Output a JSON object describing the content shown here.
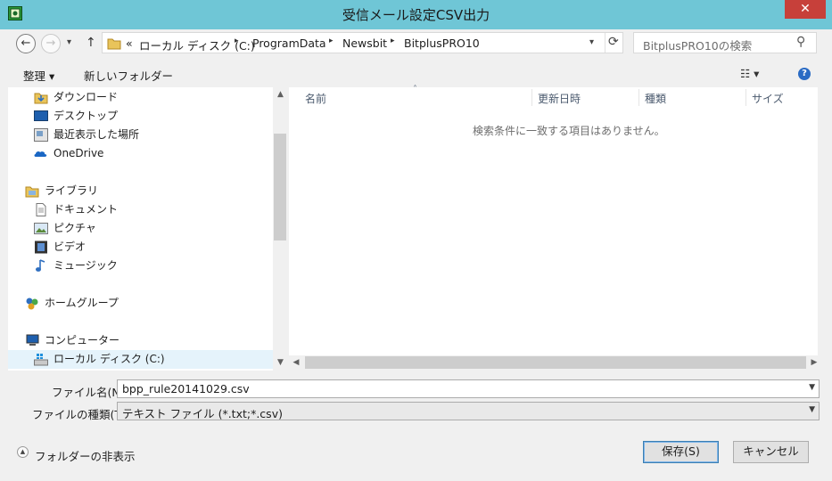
{
  "window": {
    "title": "受信メール設定CSV出力",
    "close_glyph": "✕"
  },
  "nav": {
    "back": "←",
    "forward": "→",
    "dropdown": "▾",
    "up": "↑"
  },
  "address": {
    "overflow": "«",
    "crumbs": [
      "ローカル ディスク (C:)",
      "ProgramData",
      "Newsbit",
      "BitplusPRO10"
    ],
    "dropdown": "▾",
    "refresh": "⟳"
  },
  "search": {
    "placeholder": "BitplusPRO10の検索",
    "icon": "⚲"
  },
  "toolbar": {
    "organize": "整理 ▾",
    "new_folder": "新しいフォルダー",
    "view": "☷ ▾",
    "help": "?"
  },
  "sidebar": {
    "items": [
      {
        "label": "ダウンロード",
        "icon": "download-folder-icon"
      },
      {
        "label": "デスクトップ",
        "icon": "desktop-icon"
      },
      {
        "label": "最近表示した場所",
        "icon": "recent-places-icon"
      },
      {
        "label": "OneDrive",
        "icon": "onedrive-icon"
      },
      {
        "label": "ライブラリ",
        "icon": "library-icon"
      },
      {
        "label": "ドキュメント",
        "icon": "document-icon"
      },
      {
        "label": "ピクチャ",
        "icon": "picture-icon"
      },
      {
        "label": "ビデオ",
        "icon": "video-icon"
      },
      {
        "label": "ミュージック",
        "icon": "music-icon"
      },
      {
        "label": "ホームグループ",
        "icon": "homegroup-icon"
      },
      {
        "label": "コンピューター",
        "icon": "computer-icon"
      },
      {
        "label": "ローカル ディスク (C:)",
        "icon": "local-disk-icon"
      }
    ]
  },
  "filelist": {
    "columns": [
      "名前",
      "更新日時",
      "種類",
      "サイズ"
    ],
    "sort_glyph": "˄",
    "empty_message": "検索条件に一致する項目はありません。"
  },
  "form": {
    "filename_label": "ファイル名(N):",
    "filename_value": "bpp_rule20141029.csv",
    "filetype_label": "ファイルの種類(T):",
    "filetype_value": "テキスト ファイル (*.txt;*.csv)"
  },
  "footer": {
    "hide_folders": "フォルダーの非表示",
    "save": "保存(S)",
    "cancel": "キャンセル"
  },
  "colors": {
    "titlebar": "#6fc6d6",
    "close": "#c7403a",
    "accent": "#3c7fb1"
  }
}
